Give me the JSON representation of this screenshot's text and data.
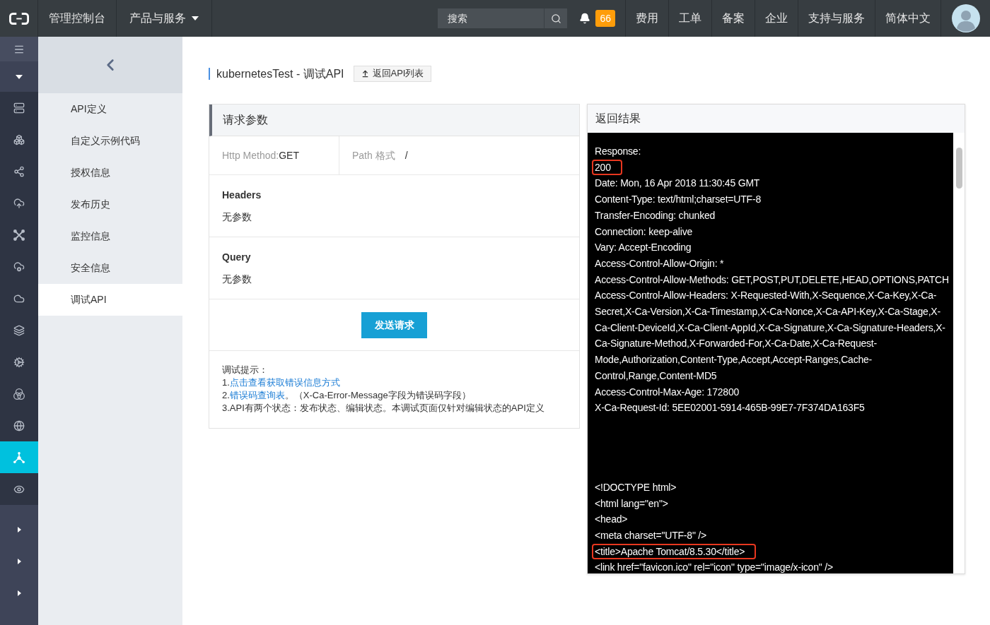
{
  "top_bar": {
    "console_link": "管理控制台",
    "products_menu": "产品与服务",
    "search": {
      "placeholder": "搜索"
    },
    "notification_count": "66",
    "nav_links": [
      "费用",
      "工单",
      "备案",
      "企业",
      "支持与服务",
      "简体中文"
    ]
  },
  "rail": {
    "items": [
      {
        "kind": "server",
        "selected": false
      },
      {
        "kind": "boxes",
        "selected": false
      },
      {
        "kind": "share",
        "selected": false
      },
      {
        "kind": "cloud-upload",
        "selected": false
      },
      {
        "kind": "cross",
        "selected": false
      },
      {
        "kind": "cloud-cog",
        "selected": false
      },
      {
        "kind": "cloud",
        "selected": false
      },
      {
        "kind": "layers",
        "selected": false
      },
      {
        "kind": "cog",
        "selected": false
      },
      {
        "kind": "rings",
        "selected": false
      },
      {
        "kind": "globe",
        "selected": false
      },
      {
        "kind": "nodes",
        "selected": true
      },
      {
        "kind": "eye",
        "selected": false
      }
    ]
  },
  "sub_nav": {
    "items": [
      {
        "label": "API定义",
        "selected": false
      },
      {
        "label": "自定义示例代码",
        "selected": false
      },
      {
        "label": "授权信息",
        "selected": false
      },
      {
        "label": "发布历史",
        "selected": false
      },
      {
        "label": "监控信息",
        "selected": false
      },
      {
        "label": "安全信息",
        "selected": false
      },
      {
        "label": "调试API",
        "selected": true
      }
    ]
  },
  "page": {
    "title": "kubernetesTest - 调试API",
    "back_button": "返回API列表"
  },
  "request_panel": {
    "title": "请求参数",
    "http_method_label": "Http Method:",
    "http_method": "GET",
    "path_label": "Path 格式",
    "path": "/",
    "sections": [
      {
        "title": "Headers",
        "value": "无参数"
      },
      {
        "title": "Query",
        "value": "无参数"
      }
    ],
    "send_button": "发送请求",
    "tips": {
      "title": "调试提示：",
      "lines": [
        {
          "prefix": "1.",
          "link": "点击查看获取错误信息方式"
        },
        {
          "prefix": "2.",
          "link": "错误码查询表",
          "suffix": "。（X-Ca-Error-Message字段为错误码字段）"
        },
        {
          "prefix": "3.API有两个状态：发布状态、编辑状态。本调试页面仅针对编辑状态的API定义"
        }
      ]
    }
  },
  "response_panel": {
    "title": "返回结果",
    "header_lines": [
      {
        "text": "Response:",
        "highlighted": false
      },
      {
        "text": "200",
        "highlighted": true
      },
      {
        "text": "Date: Mon, 16 Apr 2018 11:30:45 GMT",
        "highlighted": false
      },
      {
        "text": "Content-Type: text/html;charset=UTF-8",
        "highlighted": false
      },
      {
        "text": "Transfer-Encoding: chunked",
        "highlighted": false
      },
      {
        "text": "Connection: keep-alive",
        "highlighted": false
      },
      {
        "text": "Vary: Accept-Encoding",
        "highlighted": false
      },
      {
        "text": "Access-Control-Allow-Origin: *",
        "highlighted": false
      },
      {
        "text": "Access-Control-Allow-Methods: GET,POST,PUT,DELETE,HEAD,OPTIONS,PATCH",
        "highlighted": false
      },
      {
        "text": "Access-Control-Allow-Headers: X-Requested-With,X-Sequence,X-Ca-Key,X-Ca-Secret,X-Ca-Version,X-Ca-Timestamp,X-Ca-Nonce,X-Ca-API-Key,X-Ca-Stage,X-Ca-Client-DeviceId,X-Ca-Client-AppId,X-Ca-Signature,X-Ca-Signature-Headers,X-Ca-Signature-Method,X-Forwarded-For,X-Ca-Date,X-Ca-Request-Mode,Authorization,Content-Type,Accept,Accept-Ranges,Cache-Control,Range,Content-MD5",
        "highlighted": false
      },
      {
        "text": "Access-Control-Max-Age: 172800",
        "highlighted": false
      },
      {
        "text": "X-Ca-Request-Id: 5EE02001-5914-465B-99E7-7F374DA163F5",
        "highlighted": false
      }
    ],
    "body_lines": [
      {
        "text": "<!DOCTYPE html>",
        "highlighted": false
      },
      {
        "text": "<html lang=\"en\">",
        "highlighted": false
      },
      {
        "text": "<head>",
        "highlighted": false
      },
      {
        "text": "<meta charset=\"UTF-8\" />",
        "highlighted": false
      },
      {
        "text": "<title>Apache Tomcat/8.5.30</title>",
        "highlighted": true
      },
      {
        "text": "<link href=\"favicon.ico\" rel=\"icon\" type=\"image/x-icon\" />",
        "highlighted": false
      }
    ]
  }
}
